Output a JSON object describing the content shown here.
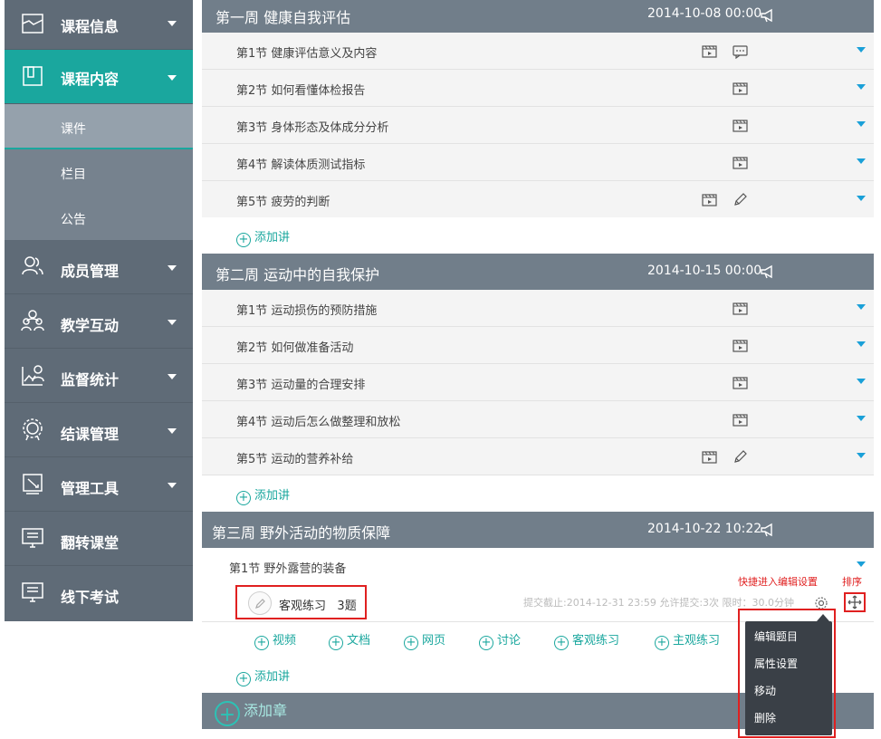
{
  "sidebar": {
    "nav": [
      {
        "label": "课程信息",
        "icon": "course-info-icon"
      },
      {
        "label": "课程内容",
        "icon": "course-content-icon"
      },
      {
        "label": "成员管理",
        "icon": "members-icon"
      },
      {
        "label": "教学互动",
        "icon": "interaction-icon"
      },
      {
        "label": "监督统计",
        "icon": "statistics-icon"
      },
      {
        "label": "结课管理",
        "icon": "completion-icon"
      },
      {
        "label": "管理工具",
        "icon": "tools-icon"
      },
      {
        "label": "翻转课堂",
        "icon": "flipped-class-icon"
      },
      {
        "label": "线下考试",
        "icon": "offline-exam-icon"
      }
    ],
    "sub": [
      "课件",
      "栏目",
      "公告"
    ]
  },
  "weeks": [
    {
      "title": "第一周 健康自我评估",
      "date": "2014-10-08 00:00",
      "lessons": [
        "第1节 健康评估意义及内容",
        "第2节 如何看懂体检报告",
        "第3节 身体形态及体成分分析",
        "第4节 解读体质测试指标",
        "第5节 疲劳的判断"
      ]
    },
    {
      "title": "第二周 运动中的自我保护",
      "date": "2014-10-15 00:00",
      "lessons": [
        "第1节 运动损伤的预防措施",
        "第2节 如何做准备活动",
        "第3节 运动量的合理安排",
        "第4节 运动后怎么做整理和放松",
        "第5节 运动的营养补给"
      ]
    },
    {
      "title": "第三周 野外活动的物质保障",
      "date": "2014-10-22 10:22",
      "lessons": [
        "第1节  野外露营的装备"
      ]
    }
  ],
  "add_lecture": "添加讲",
  "exercise": {
    "name": "客观练习",
    "count": "3题",
    "meta": "提交截止:2014-12-31 23:59 允许提交:3次 限时：30.0分钟"
  },
  "content_types": [
    "视频",
    "文档",
    "网页",
    "讨论",
    "客观练习",
    "主观练习"
  ],
  "add_chapter": "添加章",
  "annotations": {
    "quick_edit": "快捷进入编辑设置",
    "sort": "排序"
  },
  "menu": [
    "编辑题目",
    "属性设置",
    "移动",
    "删除"
  ],
  "colors": {
    "accent": "#1aa79e",
    "sidebar": "#5f6b77",
    "header": "#717e8a",
    "annotation": "#e02020"
  }
}
